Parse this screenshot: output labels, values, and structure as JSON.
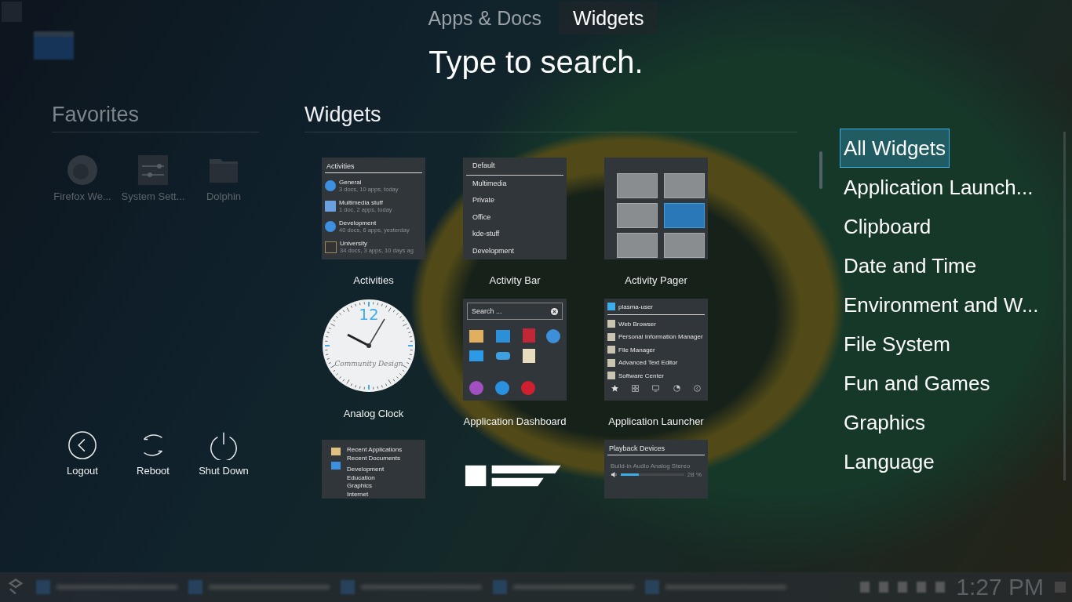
{
  "top_tabs": [
    {
      "label": "Apps & Docs",
      "selected": false
    },
    {
      "label": "Widgets",
      "selected": true
    }
  ],
  "search_prompt": "Type to search.",
  "favorites": {
    "title": "Favorites",
    "items": [
      {
        "label": "Firefox We...",
        "kind": "browser"
      },
      {
        "label": "System Sett...",
        "kind": "settings"
      },
      {
        "label": "Dolphin",
        "kind": "folder"
      }
    ]
  },
  "session_buttons": [
    {
      "label": "Logout",
      "kind": "logout"
    },
    {
      "label": "Reboot",
      "kind": "reboot"
    },
    {
      "label": "Shut Down",
      "kind": "shutdown"
    }
  ],
  "widgets": {
    "title": "Widgets",
    "items": [
      {
        "name": "Activities",
        "preview": {
          "kind": "activities",
          "title": "Activities",
          "entries": [
            {
              "name": "General",
              "detail": "3 docs, 10 apps, today"
            },
            {
              "name": "Multimedia stuff",
              "detail": "1 doc, 2 apps, today"
            },
            {
              "name": "Development",
              "detail": "40 docs, 6 apps, yesterday"
            },
            {
              "name": "University",
              "detail": "34 docs, 3 apps, 10 days ag"
            }
          ]
        }
      },
      {
        "name": "Activity Bar",
        "preview": {
          "kind": "list",
          "entries": [
            {
              "label": "Default",
              "selected": true
            },
            {
              "label": "Multimedia",
              "selected": false
            },
            {
              "label": "Private",
              "selected": false
            },
            {
              "label": "Office",
              "selected": false
            },
            {
              "label": "kde-stuff",
              "selected": false
            },
            {
              "label": "Development",
              "selected": false
            }
          ]
        }
      },
      {
        "name": "Activity Pager",
        "preview": {
          "kind": "pager",
          "desktops": [
            {
              "selected": false
            },
            {
              "selected": false
            },
            {
              "selected": false
            },
            {
              "selected": true
            },
            {
              "selected": false
            },
            {
              "selected": false
            }
          ]
        }
      },
      {
        "name": "Analog Clock",
        "preview": {
          "kind": "clock",
          "numeral": "12",
          "caption": "Community Design"
        }
      },
      {
        "name": "Application Dashboard",
        "preview": {
          "kind": "dashboard",
          "placeholder": "Search ..."
        }
      },
      {
        "name": "Application Launcher",
        "preview": {
          "kind": "launcher",
          "user": "plasma-user",
          "entries": [
            "Web Browser",
            "Personal Information Manager",
            "File Manager",
            "Advanced Text Editor",
            "Software Center"
          ]
        }
      },
      {
        "preview": {
          "kind": "menu",
          "top_entries": [
            "Recent Applications",
            "Recent Documents"
          ],
          "entries": [
            "Development",
            "Education",
            "Graphics",
            "Internet"
          ]
        }
      },
      {
        "preview": {
          "kind": "logo"
        }
      },
      {
        "preview": {
          "kind": "volume",
          "title": "Playback Devices",
          "device": "Build-in Audio Analog Stereo",
          "level": 0.28,
          "reading": "28 %"
        }
      }
    ]
  },
  "categories": [
    {
      "label": "All Widgets",
      "selected": true
    },
    {
      "label": "Application Launch...",
      "selected": false
    },
    {
      "label": "Clipboard",
      "selected": false
    },
    {
      "label": "Date and Time",
      "selected": false
    },
    {
      "label": "Environment and W...",
      "selected": false
    },
    {
      "label": "File System",
      "selected": false
    },
    {
      "label": "Fun and Games",
      "selected": false
    },
    {
      "label": "Graphics",
      "selected": false
    },
    {
      "label": "Language",
      "selected": false
    }
  ],
  "taskbar": {
    "clock": "1:27 PM"
  }
}
